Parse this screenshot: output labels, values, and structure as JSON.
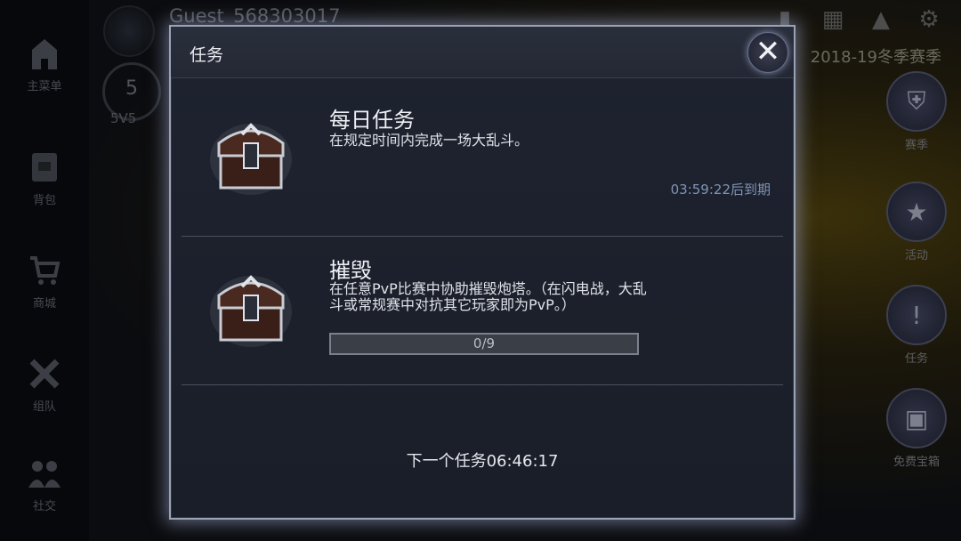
{
  "background": {
    "player_name": "Guest_568303017",
    "rank_level": "5",
    "rank_label": "5V5",
    "season_title": "2018-19冬季赛季",
    "left_nav": [
      {
        "label": "主菜单",
        "icon": "castle-icon"
      },
      {
        "label": "背包",
        "icon": "backpack-icon"
      },
      {
        "label": "商城",
        "icon": "cart-icon"
      },
      {
        "label": "组队",
        "icon": "swords-icon"
      },
      {
        "label": "社交",
        "icon": "people-icon"
      }
    ],
    "right_side": [
      {
        "label": "赛季",
        "icon": "helmet-icon"
      },
      {
        "label": "活动",
        "icon": "star-calendar-icon"
      },
      {
        "label": "任务",
        "icon": "exclamation-shield-icon"
      },
      {
        "label": "免费宝箱",
        "icon": "chest-icon"
      }
    ]
  },
  "modal": {
    "title": "任务",
    "close_icon": "close-icon",
    "missions": [
      {
        "title": "每日任务",
        "description": "在规定时间内完成一场大乱斗。",
        "expire": "03:59:22后到期"
      },
      {
        "title": "摧毁",
        "description": "在任意PvP比赛中协助摧毁炮塔。（在闪电战，大乱斗或常规赛中对抗其它玩家即为PvP。）",
        "progress_text": "0/9",
        "progress_fraction": 0
      }
    ],
    "next_mission": "下一个任务06:46:17"
  },
  "colors": {
    "modal_border": "#9aa3b6",
    "expire_text": "#7f93b5",
    "modal_bg": "#1e2330"
  }
}
